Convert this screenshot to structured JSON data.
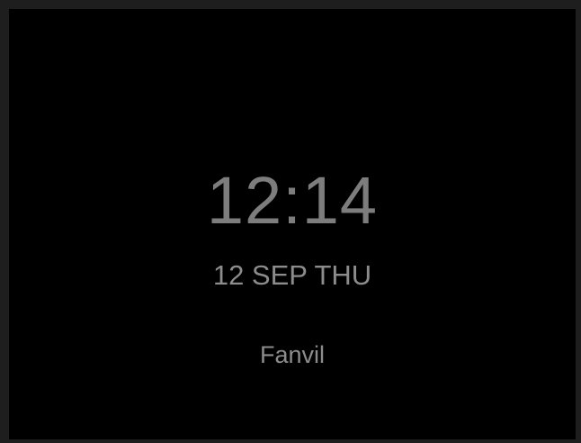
{
  "idle_screen": {
    "time": "12:14",
    "date": "12 SEP THU",
    "brand": "Fanvil"
  }
}
